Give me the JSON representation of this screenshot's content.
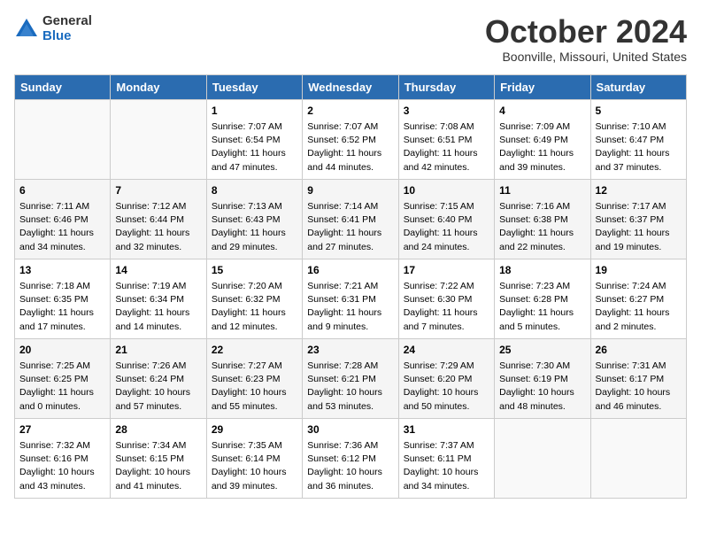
{
  "header": {
    "logo_general": "General",
    "logo_blue": "Blue",
    "month": "October 2024",
    "location": "Boonville, Missouri, United States"
  },
  "weekdays": [
    "Sunday",
    "Monday",
    "Tuesday",
    "Wednesday",
    "Thursday",
    "Friday",
    "Saturday"
  ],
  "weeks": [
    [
      {
        "day": "",
        "sunrise": "",
        "sunset": "",
        "daylight": ""
      },
      {
        "day": "",
        "sunrise": "",
        "sunset": "",
        "daylight": ""
      },
      {
        "day": "1",
        "sunrise": "Sunrise: 7:07 AM",
        "sunset": "Sunset: 6:54 PM",
        "daylight": "Daylight: 11 hours and 47 minutes."
      },
      {
        "day": "2",
        "sunrise": "Sunrise: 7:07 AM",
        "sunset": "Sunset: 6:52 PM",
        "daylight": "Daylight: 11 hours and 44 minutes."
      },
      {
        "day": "3",
        "sunrise": "Sunrise: 7:08 AM",
        "sunset": "Sunset: 6:51 PM",
        "daylight": "Daylight: 11 hours and 42 minutes."
      },
      {
        "day": "4",
        "sunrise": "Sunrise: 7:09 AM",
        "sunset": "Sunset: 6:49 PM",
        "daylight": "Daylight: 11 hours and 39 minutes."
      },
      {
        "day": "5",
        "sunrise": "Sunrise: 7:10 AM",
        "sunset": "Sunset: 6:47 PM",
        "daylight": "Daylight: 11 hours and 37 minutes."
      }
    ],
    [
      {
        "day": "6",
        "sunrise": "Sunrise: 7:11 AM",
        "sunset": "Sunset: 6:46 PM",
        "daylight": "Daylight: 11 hours and 34 minutes."
      },
      {
        "day": "7",
        "sunrise": "Sunrise: 7:12 AM",
        "sunset": "Sunset: 6:44 PM",
        "daylight": "Daylight: 11 hours and 32 minutes."
      },
      {
        "day": "8",
        "sunrise": "Sunrise: 7:13 AM",
        "sunset": "Sunset: 6:43 PM",
        "daylight": "Daylight: 11 hours and 29 minutes."
      },
      {
        "day": "9",
        "sunrise": "Sunrise: 7:14 AM",
        "sunset": "Sunset: 6:41 PM",
        "daylight": "Daylight: 11 hours and 27 minutes."
      },
      {
        "day": "10",
        "sunrise": "Sunrise: 7:15 AM",
        "sunset": "Sunset: 6:40 PM",
        "daylight": "Daylight: 11 hours and 24 minutes."
      },
      {
        "day": "11",
        "sunrise": "Sunrise: 7:16 AM",
        "sunset": "Sunset: 6:38 PM",
        "daylight": "Daylight: 11 hours and 22 minutes."
      },
      {
        "day": "12",
        "sunrise": "Sunrise: 7:17 AM",
        "sunset": "Sunset: 6:37 PM",
        "daylight": "Daylight: 11 hours and 19 minutes."
      }
    ],
    [
      {
        "day": "13",
        "sunrise": "Sunrise: 7:18 AM",
        "sunset": "Sunset: 6:35 PM",
        "daylight": "Daylight: 11 hours and 17 minutes."
      },
      {
        "day": "14",
        "sunrise": "Sunrise: 7:19 AM",
        "sunset": "Sunset: 6:34 PM",
        "daylight": "Daylight: 11 hours and 14 minutes."
      },
      {
        "day": "15",
        "sunrise": "Sunrise: 7:20 AM",
        "sunset": "Sunset: 6:32 PM",
        "daylight": "Daylight: 11 hours and 12 minutes."
      },
      {
        "day": "16",
        "sunrise": "Sunrise: 7:21 AM",
        "sunset": "Sunset: 6:31 PM",
        "daylight": "Daylight: 11 hours and 9 minutes."
      },
      {
        "day": "17",
        "sunrise": "Sunrise: 7:22 AM",
        "sunset": "Sunset: 6:30 PM",
        "daylight": "Daylight: 11 hours and 7 minutes."
      },
      {
        "day": "18",
        "sunrise": "Sunrise: 7:23 AM",
        "sunset": "Sunset: 6:28 PM",
        "daylight": "Daylight: 11 hours and 5 minutes."
      },
      {
        "day": "19",
        "sunrise": "Sunrise: 7:24 AM",
        "sunset": "Sunset: 6:27 PM",
        "daylight": "Daylight: 11 hours and 2 minutes."
      }
    ],
    [
      {
        "day": "20",
        "sunrise": "Sunrise: 7:25 AM",
        "sunset": "Sunset: 6:25 PM",
        "daylight": "Daylight: 11 hours and 0 minutes."
      },
      {
        "day": "21",
        "sunrise": "Sunrise: 7:26 AM",
        "sunset": "Sunset: 6:24 PM",
        "daylight": "Daylight: 10 hours and 57 minutes."
      },
      {
        "day": "22",
        "sunrise": "Sunrise: 7:27 AM",
        "sunset": "Sunset: 6:23 PM",
        "daylight": "Daylight: 10 hours and 55 minutes."
      },
      {
        "day": "23",
        "sunrise": "Sunrise: 7:28 AM",
        "sunset": "Sunset: 6:21 PM",
        "daylight": "Daylight: 10 hours and 53 minutes."
      },
      {
        "day": "24",
        "sunrise": "Sunrise: 7:29 AM",
        "sunset": "Sunset: 6:20 PM",
        "daylight": "Daylight: 10 hours and 50 minutes."
      },
      {
        "day": "25",
        "sunrise": "Sunrise: 7:30 AM",
        "sunset": "Sunset: 6:19 PM",
        "daylight": "Daylight: 10 hours and 48 minutes."
      },
      {
        "day": "26",
        "sunrise": "Sunrise: 7:31 AM",
        "sunset": "Sunset: 6:17 PM",
        "daylight": "Daylight: 10 hours and 46 minutes."
      }
    ],
    [
      {
        "day": "27",
        "sunrise": "Sunrise: 7:32 AM",
        "sunset": "Sunset: 6:16 PM",
        "daylight": "Daylight: 10 hours and 43 minutes."
      },
      {
        "day": "28",
        "sunrise": "Sunrise: 7:34 AM",
        "sunset": "Sunset: 6:15 PM",
        "daylight": "Daylight: 10 hours and 41 minutes."
      },
      {
        "day": "29",
        "sunrise": "Sunrise: 7:35 AM",
        "sunset": "Sunset: 6:14 PM",
        "daylight": "Daylight: 10 hours and 39 minutes."
      },
      {
        "day": "30",
        "sunrise": "Sunrise: 7:36 AM",
        "sunset": "Sunset: 6:12 PM",
        "daylight": "Daylight: 10 hours and 36 minutes."
      },
      {
        "day": "31",
        "sunrise": "Sunrise: 7:37 AM",
        "sunset": "Sunset: 6:11 PM",
        "daylight": "Daylight: 10 hours and 34 minutes."
      },
      {
        "day": "",
        "sunrise": "",
        "sunset": "",
        "daylight": ""
      },
      {
        "day": "",
        "sunrise": "",
        "sunset": "",
        "daylight": ""
      }
    ]
  ]
}
